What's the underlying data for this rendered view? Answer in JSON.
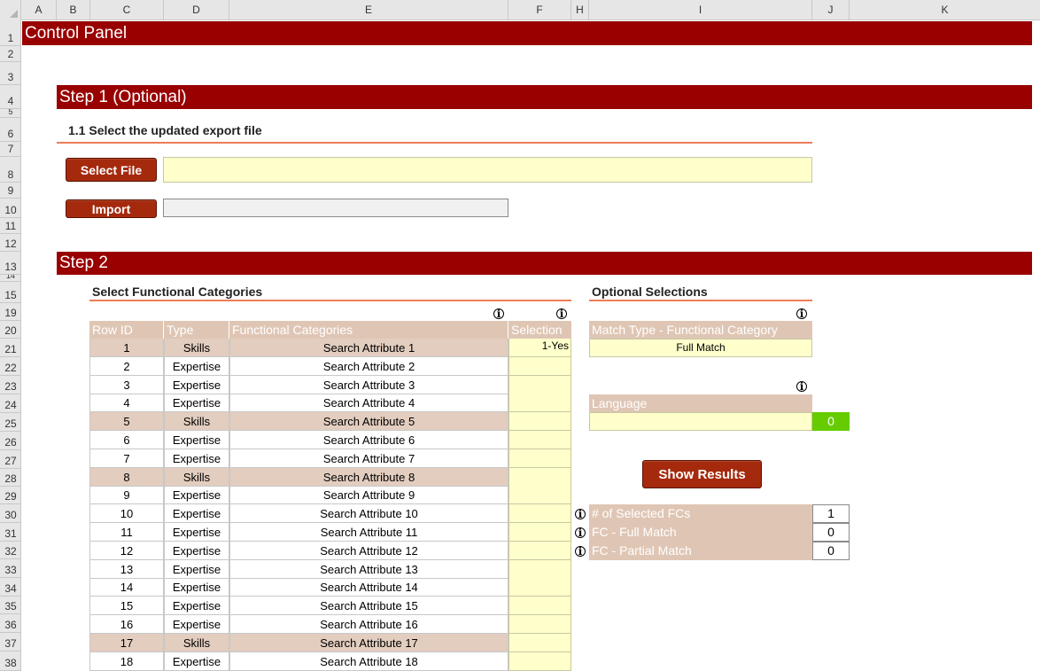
{
  "columns": [
    "A",
    "B",
    "C",
    "D",
    "E",
    "F",
    "H",
    "I",
    "J",
    "K"
  ],
  "rows": [
    "1",
    "2",
    "3",
    "4",
    "5",
    "6",
    "7",
    "8",
    "9",
    "10",
    "11",
    "12",
    "13",
    "14",
    "15",
    "19",
    "20",
    "21",
    "22",
    "23",
    "24",
    "25",
    "26",
    "27",
    "28",
    "29",
    "30",
    "31",
    "32",
    "33",
    "34",
    "35",
    "36",
    "37",
    "38"
  ],
  "title": "Control Panel",
  "step1": {
    "banner": "Step 1 (Optional)",
    "subtitle": "1.1  Select the updated export file",
    "select_file_label": "Select File",
    "import_label": "Import"
  },
  "step2": {
    "banner": "Step 2",
    "fc_title": "Select Functional Categories",
    "optional_title": "Optional Selections",
    "table_headers": [
      "Row ID",
      "Type",
      "Functional Categories",
      "Selection"
    ],
    "table_rows": [
      {
        "id": "1",
        "type": "Skills",
        "fc": "Search Attribute 1",
        "sel": "1-Yes"
      },
      {
        "id": "2",
        "type": "Expertise",
        "fc": "Search Attribute 2",
        "sel": ""
      },
      {
        "id": "3",
        "type": "Expertise",
        "fc": "Search Attribute 3",
        "sel": ""
      },
      {
        "id": "4",
        "type": "Expertise",
        "fc": "Search Attribute 4",
        "sel": ""
      },
      {
        "id": "5",
        "type": "Skills",
        "fc": "Search Attribute 5",
        "sel": ""
      },
      {
        "id": "6",
        "type": "Expertise",
        "fc": "Search Attribute 6",
        "sel": ""
      },
      {
        "id": "7",
        "type": "Expertise",
        "fc": "Search Attribute 7",
        "sel": ""
      },
      {
        "id": "8",
        "type": "Skills",
        "fc": "Search Attribute 8",
        "sel": ""
      },
      {
        "id": "9",
        "type": "Expertise",
        "fc": "Search Attribute 9",
        "sel": ""
      },
      {
        "id": "10",
        "type": "Expertise",
        "fc": "Search Attribute 10",
        "sel": ""
      },
      {
        "id": "11",
        "type": "Expertise",
        "fc": "Search Attribute 11",
        "sel": ""
      },
      {
        "id": "12",
        "type": "Expertise",
        "fc": "Search Attribute 12",
        "sel": ""
      },
      {
        "id": "13",
        "type": "Expertise",
        "fc": "Search Attribute 13",
        "sel": ""
      },
      {
        "id": "14",
        "type": "Expertise",
        "fc": "Search Attribute 14",
        "sel": ""
      },
      {
        "id": "15",
        "type": "Expertise",
        "fc": "Search Attribute 15",
        "sel": ""
      },
      {
        "id": "16",
        "type": "Expertise",
        "fc": "Search Attribute 16",
        "sel": ""
      },
      {
        "id": "17",
        "type": "Skills",
        "fc": "Search Attribute 17",
        "sel": ""
      },
      {
        "id": "18",
        "type": "Expertise",
        "fc": "Search Attribute 18",
        "sel": ""
      }
    ],
    "match_type_header": "Match Type - Functional Category",
    "match_type_value": "Full Match",
    "language_header": "Language",
    "language_value": "",
    "language_count": "0",
    "show_results_label": "Show Results",
    "stats": [
      {
        "label": "# of Selected FCs",
        "value": "1"
      },
      {
        "label": "FC - Full Match",
        "value": "0"
      },
      {
        "label": "FC - Partial Match",
        "value": "0"
      }
    ]
  },
  "colors": {
    "banner": "#990000",
    "button": "#a52a0d",
    "header_fill": "#dfc6b4",
    "input_fill": "#ffffcc",
    "accent_rule": "#ed7d5a",
    "count_fill": "#66cc00"
  },
  "icons": {
    "info": "info-icon"
  }
}
